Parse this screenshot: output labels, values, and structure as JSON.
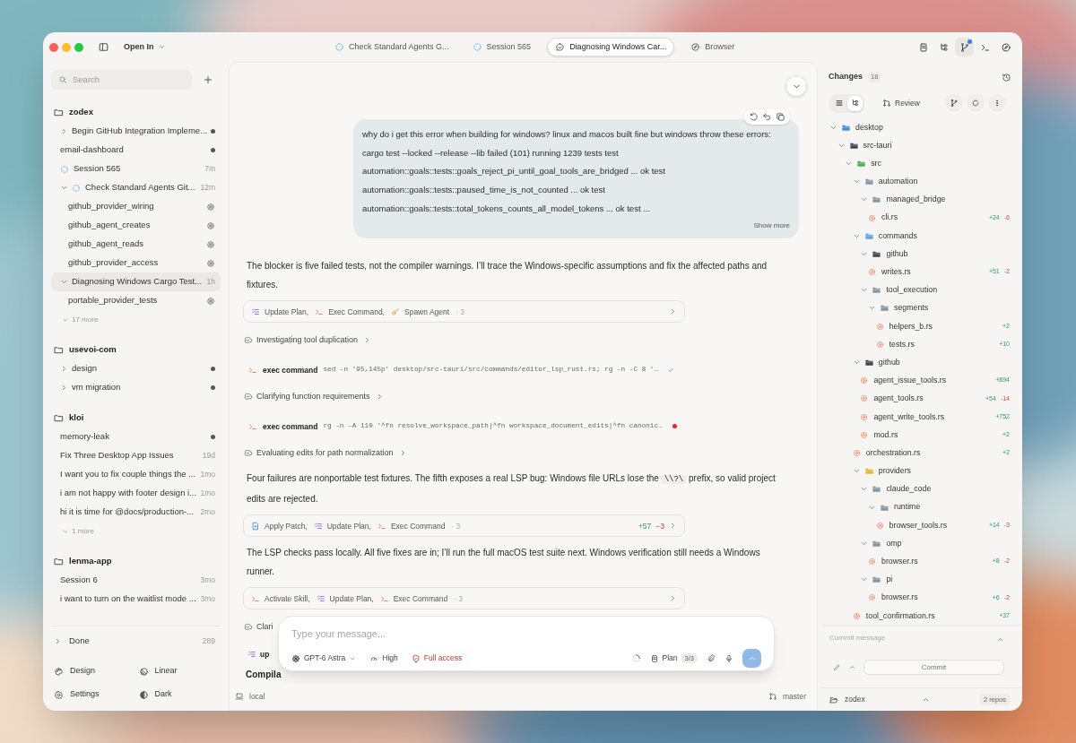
{
  "titlebar": {
    "open_in": "Open In",
    "tabs": [
      {
        "label": "Check Standard Agents G...",
        "kind": "spinner",
        "selected": false
      },
      {
        "label": "Session 565",
        "kind": "spinner",
        "selected": false
      },
      {
        "label": "Diagnosing Windows Car...",
        "kind": "chat",
        "selected": true
      },
      {
        "label": "Browser",
        "kind": "compass",
        "selected": false
      }
    ],
    "tools": [
      {
        "kind": "notes",
        "selected": false,
        "notify": false
      },
      {
        "kind": "tree",
        "selected": false,
        "notify": false
      },
      {
        "kind": "branch",
        "selected": true,
        "notify": true
      },
      {
        "kind": "terminal",
        "selected": false,
        "notify": false
      },
      {
        "kind": "compass",
        "selected": false,
        "notify": false
      }
    ]
  },
  "sidebar": {
    "search": {
      "placeholder": "Search"
    },
    "projects": [
      {
        "name": "zodex",
        "items": [
          {
            "title": "Begin GitHub Integration Impleme...",
            "expanded": false,
            "unread": true,
            "selected": false
          },
          {
            "title": "email-dashboard",
            "unread": true,
            "selected": false
          },
          {
            "title": "Session 565",
            "spinner": true,
            "time": "7m",
            "unread": false,
            "selected": false
          },
          {
            "title": "Check Standard Agents Git...",
            "expanded": true,
            "spinner": true,
            "time": "12m",
            "unread": false,
            "selected": false,
            "children": [
              {
                "title": "github_provider_wiring",
                "kind": "agent",
                "selected": false
              },
              {
                "title": "github_agent_creates",
                "kind": "agent",
                "selected": false
              },
              {
                "title": "github_agent_reads",
                "kind": "agent",
                "selected": false
              },
              {
                "title": "github_provider_access",
                "kind": "agent",
                "selected": false
              }
            ]
          },
          {
            "title": "Diagnosing Windows Cargo Test...",
            "expanded": true,
            "time": "1h",
            "unread": false,
            "selected": true,
            "children": [
              {
                "title": "portable_provider_tests",
                "kind": "agent",
                "selected": false
              }
            ]
          }
        ],
        "more": "17 more"
      },
      {
        "name": "usevoi-com",
        "items": [
          {
            "title": "design",
            "expanded": false,
            "unread": true,
            "selected": false
          },
          {
            "title": "vm migration",
            "expanded": false,
            "unread": true,
            "selected": false
          }
        ]
      },
      {
        "name": "kloi",
        "items": [
          {
            "title": "memory-leak",
            "unread": true,
            "selected": false
          },
          {
            "title": "Fix Three Desktop App Issues",
            "time": "19d",
            "unread": false,
            "selected": false
          },
          {
            "title": "I want you to fix couple things the ...",
            "time": "1mo",
            "unread": false,
            "selected": false
          },
          {
            "title": "i am not happy with footer design i...",
            "time": "1mo",
            "unread": false,
            "selected": false
          },
          {
            "title": "hi it is time for @docs/production-...",
            "time": "2mo",
            "unread": false,
            "selected": false
          }
        ],
        "more": "1 more"
      },
      {
        "name": "lenma-app",
        "items": [
          {
            "title": "Session 6",
            "time": "3mo",
            "unread": false,
            "selected": false
          },
          {
            "title": "i want to turn on the waitlist mode ...",
            "time": "3mo",
            "unread": false,
            "selected": false
          }
        ]
      }
    ],
    "done": {
      "label": "Done",
      "count": "289",
      "expanded": false
    },
    "footer": [
      {
        "kind": "palette",
        "label": "Design"
      },
      {
        "kind": "linear",
        "label": "Linear"
      },
      {
        "kind": "settings",
        "label": "Settings"
      },
      {
        "kind": "contrast",
        "label": "Dark"
      }
    ]
  },
  "conversation": {
    "messages": [
      {
        "kind": "user",
        "lines": [
          "why do i get this error when building for windows? linux and macos built fine but windows throw these errors:",
          "cargo test --locked --release --lib failed (101) running 1239 tests test",
          "automation::goals::tests::goals_reject_pi_until_goal_tools_are_bridged ... ok test",
          "automation::goals::tests::paused_time_is_not_counted ... ok test",
          "automation::goals::tests::total_tokens_counts_all_model_tokens ... ok test ..."
        ],
        "show_more": "Show more"
      },
      {
        "kind": "text",
        "parts": [
          {
            "text": "The blocker is five failed tests, not the compiler warnings. I’ll trace the Windows-specific assumptions and fix the affected paths and fixtures."
          }
        ]
      },
      {
        "kind": "tools",
        "tools": [
          {
            "kind": "plan",
            "label": "Update Plan,"
          },
          {
            "kind": "exec",
            "label": "Exec Command,"
          },
          {
            "kind": "key",
            "label": "Spawn Agent"
          }
        ],
        "count": "· 3"
      },
      {
        "kind": "thinking",
        "title": "Investigating tool duplication"
      },
      {
        "kind": "exec",
        "label": "exec command",
        "command": "sed -n '95,145p' desktop/src-tauri/src/commands/editor_lsp_rust.rs; rg -n -C 8 '…",
        "passed": true
      },
      {
        "kind": "thinking",
        "title": "Clarifying function requirements"
      },
      {
        "kind": "exec",
        "label": "exec command",
        "command": "rg -n -A 110 '^fn resolve_workspace_path|^fn workspace_document_edits|^fn canonic…",
        "passed": false
      },
      {
        "kind": "thinking",
        "title": "Evaluating edits for path normalization"
      },
      {
        "kind": "text",
        "parts": [
          {
            "text": "Four failures are nonportable test fixtures. The fifth exposes a real LSP bug: Windows file URLs lose the "
          },
          {
            "code": "\\\\?\\"
          },
          {
            "text": " prefix, so valid project edits are rejected."
          }
        ]
      },
      {
        "kind": "tools",
        "tools": [
          {
            "kind": "patch",
            "label": "Apply Patch,"
          },
          {
            "kind": "plan",
            "label": "Update Plan,"
          },
          {
            "kind": "exec",
            "label": "Exec Command"
          }
        ],
        "count": "· 3",
        "additions": "+57",
        "deletions": "−3"
      },
      {
        "kind": "text",
        "parts": [
          {
            "text": "The LSP checks pass locally. All five fixes are in; I’ll run the full macOS test suite next. Windows verification still needs a Windows runner."
          }
        ]
      },
      {
        "kind": "tools",
        "tools": [
          {
            "kind": "exec",
            "label": "Activate Skill,"
          },
          {
            "kind": "plan",
            "label": "Update Plan,"
          },
          {
            "kind": "exec",
            "label": "Exec Command"
          }
        ],
        "count": "· 3"
      },
      {
        "kind": "thinking_cut",
        "title": "Clari"
      },
      {
        "kind": "step",
        "label": "up"
      },
      {
        "kind": "bold_text",
        "text": "Compila"
      }
    ],
    "composer": {
      "placeholder": "Type your message...",
      "model": "GPT-6 Astra",
      "effort": "High",
      "access": "Full access",
      "plan": "Plan",
      "plan_count": "3/3"
    },
    "footer": {
      "location": "local",
      "branch": "master"
    }
  },
  "changes": {
    "title": "Changes",
    "count": "18",
    "views": [
      {
        "kind": "list",
        "selected": false
      },
      {
        "kind": "tree",
        "selected": true
      }
    ],
    "review": "Review",
    "tree": [
      {
        "name": "desktop",
        "color": "#3f8fdc",
        "expanded": true,
        "children": [
          {
            "name": "src-tauri",
            "color": "#3d4852",
            "expanded": true,
            "children": [
              {
                "name": "src",
                "color": "#4fae5a",
                "expanded": true,
                "children": [
                  {
                    "name": "automation",
                    "color": "#8697a3",
                    "expanded": true,
                    "children": [
                      {
                        "name": "managed_bridge",
                        "color": "#8697a3",
                        "expanded": true,
                        "children": [
                          {
                            "name": "cli.rs",
                            "additions": "+24",
                            "deletions": "-6"
                          }
                        ]
                      }
                    ]
                  },
                  {
                    "name": "commands",
                    "color": "#5aa6e6",
                    "expanded": true,
                    "children": [
                      {
                        "name": "github",
                        "color": "#3d4852",
                        "expanded": true,
                        "children": [
                          {
                            "name": "writes.rs",
                            "additions": "+51",
                            "deletions": "-2"
                          }
                        ]
                      },
                      {
                        "name": "tool_execution",
                        "color": "#8697a3",
                        "expanded": true,
                        "children": [
                          {
                            "name": "segments",
                            "color": "#8697a3",
                            "expanded": true,
                            "children": [
                              {
                                "name": "helpers_b.rs",
                                "additions": "+2"
                              },
                              {
                                "name": "tests.rs",
                                "additions": "+10"
                              }
                            ]
                          }
                        ]
                      }
                    ]
                  },
                  {
                    "name": "github",
                    "color": "#3d4852",
                    "expanded": true,
                    "children": [
                      {
                        "name": "agent_issue_tools.rs",
                        "additions": "+894"
                      },
                      {
                        "name": "agent_tools.rs",
                        "additions": "+54",
                        "deletions": "-14"
                      },
                      {
                        "name": "agent_write_tools.rs",
                        "additions": "+752"
                      },
                      {
                        "name": "mod.rs",
                        "additions": "+2"
                      }
                    ]
                  },
                  {
                    "name": "orchestration.rs",
                    "additions": "+2"
                  },
                  {
                    "name": "providers",
                    "color": "#e6b631",
                    "expanded": true,
                    "children": [
                      {
                        "name": "claude_code",
                        "color": "#8697a3",
                        "expanded": true,
                        "children": [
                          {
                            "name": "runtime",
                            "color": "#8697a3",
                            "expanded": true,
                            "children": [
                              {
                                "name": "browser_tools.rs",
                                "additions": "+14",
                                "deletions": "-3"
                              }
                            ]
                          }
                        ]
                      },
                      {
                        "name": "omp",
                        "color": "#8697a3",
                        "expanded": true,
                        "children": [
                          {
                            "name": "browser.rs",
                            "additions": "+8",
                            "deletions": "-2"
                          }
                        ]
                      },
                      {
                        "name": "pi",
                        "color": "#8697a3",
                        "expanded": true,
                        "children": [
                          {
                            "name": "browser.rs",
                            "additions": "+6",
                            "deletions": "-2"
                          }
                        ]
                      }
                    ]
                  },
                  {
                    "name": "tool_confirmation.rs",
                    "additions": "+37"
                  }
                ]
              }
            ]
          }
        ]
      }
    ],
    "commit": {
      "placeholder": "Commit message",
      "button": "Commit"
    },
    "repo": {
      "name": "zodex",
      "count": "2 repos"
    }
  }
}
